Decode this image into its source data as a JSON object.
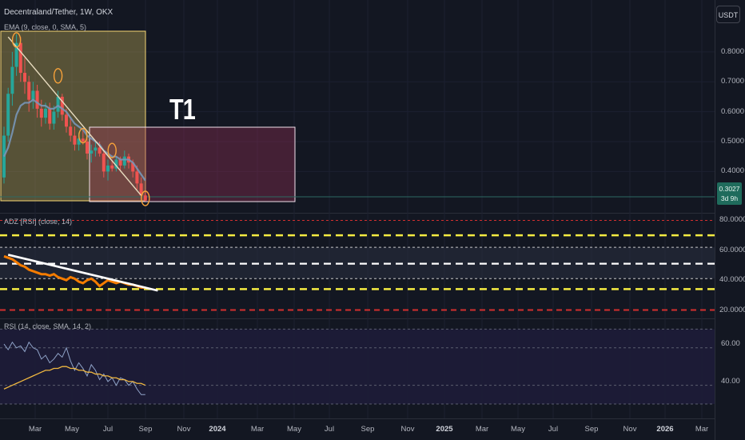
{
  "header": {
    "symbol_title": "Decentraland/Tether, 1W, OKX",
    "indicator_1": "EMA (9, close, 0, SMA, 5)",
    "currency_button": "USDT",
    "price_tag": "0.3027",
    "price_countdown": "3d 9h",
    "annotation": "T1"
  },
  "panes": {
    "adz_title": "ADZ [RSI] (close, 14)",
    "rsi_title": "RSI (14, close, SMA, 14, 2)"
  },
  "colors": {
    "background": "#131722",
    "bull": "#26a69a",
    "bear": "#ef5350",
    "ema": "#7896b8",
    "trendline": "#e8dcc0",
    "zone_yellow": "#c8b45a",
    "zone_pink": "#a0325a",
    "circle": "#f7a23a",
    "rsi_line": "#f57c00",
    "rsi_thin": "#8fa3c8",
    "rsi_ma": "#f0b840",
    "dash_yellow": "#f5ec42",
    "dash_red": "#d32f2f"
  },
  "axes": {
    "price_ticks": [
      "0.8000",
      "0.7000",
      "0.6000",
      "0.5000",
      "0.4000"
    ],
    "adz_ticks": [
      "80.0000",
      "60.0000",
      "40.0000",
      "20.0000"
    ],
    "rsi_ticks": [
      "60.00",
      "40.00"
    ],
    "time_ticks": [
      {
        "label": "Mar",
        "bold": false
      },
      {
        "label": "May",
        "bold": false
      },
      {
        "label": "Jul",
        "bold": false
      },
      {
        "label": "Sep",
        "bold": false
      },
      {
        "label": "Nov",
        "bold": false
      },
      {
        "label": "2024",
        "bold": true
      },
      {
        "label": "Mar",
        "bold": false
      },
      {
        "label": "May",
        "bold": false
      },
      {
        "label": "Jul",
        "bold": false
      },
      {
        "label": "Sep",
        "bold": false
      },
      {
        "label": "Nov",
        "bold": false
      },
      {
        "label": "2025",
        "bold": true
      },
      {
        "label": "Mar",
        "bold": false
      },
      {
        "label": "May",
        "bold": false
      },
      {
        "label": "Jul",
        "bold": false
      },
      {
        "label": "Sep",
        "bold": false
      },
      {
        "label": "Nov",
        "bold": false
      },
      {
        "label": "2026",
        "bold": true
      },
      {
        "label": "Mar",
        "bold": false
      }
    ]
  },
  "chart_data": [
    {
      "type": "candlestick",
      "ylim": [
        0.31,
        0.88
      ],
      "current_price": 0.3027,
      "price_line": 0.31,
      "candles": [
        [
          0.38,
          0.55,
          0.36,
          0.52
        ],
        [
          0.52,
          0.68,
          0.5,
          0.66
        ],
        [
          0.66,
          0.8,
          0.62,
          0.75
        ],
        [
          0.75,
          0.86,
          0.72,
          0.83
        ],
        [
          0.83,
          0.85,
          0.7,
          0.73
        ],
        [
          0.73,
          0.78,
          0.66,
          0.7
        ],
        [
          0.7,
          0.72,
          0.6,
          0.64
        ],
        [
          0.64,
          0.7,
          0.61,
          0.67
        ],
        [
          0.67,
          0.69,
          0.58,
          0.61
        ],
        [
          0.61,
          0.64,
          0.55,
          0.58
        ],
        [
          0.58,
          0.63,
          0.56,
          0.61
        ],
        [
          0.61,
          0.63,
          0.54,
          0.56
        ],
        [
          0.56,
          0.62,
          0.54,
          0.6
        ],
        [
          0.6,
          0.67,
          0.58,
          0.65
        ],
        [
          0.65,
          0.66,
          0.57,
          0.59
        ],
        [
          0.59,
          0.61,
          0.53,
          0.55
        ],
        [
          0.55,
          0.58,
          0.5,
          0.52
        ],
        [
          0.52,
          0.55,
          0.47,
          0.49
        ],
        [
          0.49,
          0.53,
          0.47,
          0.51
        ],
        [
          0.51,
          0.54,
          0.49,
          0.5
        ],
        [
          0.5,
          0.52,
          0.44,
          0.46
        ],
        [
          0.46,
          0.49,
          0.43,
          0.47
        ],
        [
          0.47,
          0.5,
          0.45,
          0.48
        ],
        [
          0.48,
          0.5,
          0.45,
          0.46
        ],
        [
          0.46,
          0.47,
          0.38,
          0.4
        ],
        [
          0.4,
          0.44,
          0.37,
          0.42
        ],
        [
          0.42,
          0.44,
          0.4,
          0.41
        ],
        [
          0.41,
          0.45,
          0.4,
          0.44
        ],
        [
          0.44,
          0.45,
          0.4,
          0.42
        ],
        [
          0.42,
          0.47,
          0.41,
          0.45
        ],
        [
          0.45,
          0.46,
          0.41,
          0.43
        ],
        [
          0.43,
          0.44,
          0.38,
          0.4
        ],
        [
          0.4,
          0.42,
          0.34,
          0.36
        ],
        [
          0.36,
          0.38,
          0.31,
          0.32
        ],
        [
          0.32,
          0.33,
          0.3,
          0.3027
        ]
      ],
      "ema": [
        0.45,
        0.48,
        0.53,
        0.59,
        0.62,
        0.63,
        0.63,
        0.64,
        0.63,
        0.62,
        0.62,
        0.61,
        0.61,
        0.62,
        0.61,
        0.6,
        0.58,
        0.56,
        0.55,
        0.54,
        0.52,
        0.51,
        0.5,
        0.49,
        0.47,
        0.46,
        0.45,
        0.45,
        0.44,
        0.44,
        0.44,
        0.43,
        0.41,
        0.39,
        0.37
      ],
      "trendline": [
        [
          1,
          0.85
        ],
        [
          33,
          0.32
        ]
      ],
      "circles": [
        [
          3,
          0.84
        ],
        [
          13,
          0.72
        ],
        [
          19,
          0.52
        ],
        [
          26,
          0.47
        ],
        [
          34,
          0.31
        ]
      ]
    },
    {
      "type": "line",
      "name": "ADZ [RSI]",
      "ylim": [
        16,
        84
      ],
      "levels": {
        "red_top": 80,
        "yellow_top": 70,
        "white_1": 62,
        "white_2": 51,
        "white_3": 41,
        "yellow_bottom": 34,
        "red_bottom": 20
      },
      "values": [
        56,
        55,
        54,
        52,
        50,
        49,
        47,
        46,
        45,
        44,
        44,
        43,
        44,
        42,
        41,
        40,
        42,
        41,
        39,
        38,
        40,
        41,
        39,
        36,
        38,
        40,
        39,
        38,
        39,
        38,
        37,
        37,
        36,
        35,
        35
      ],
      "trendline": [
        [
          1,
          57
        ],
        [
          37,
          33
        ]
      ]
    },
    {
      "type": "line",
      "name": "RSI",
      "ylim": [
        28,
        72
      ],
      "levels": [
        68,
        58,
        38,
        28
      ],
      "rsi": [
        60,
        57,
        61,
        58,
        59,
        56,
        61,
        58,
        57,
        52,
        54,
        50,
        52,
        55,
        53,
        58,
        51,
        46,
        50,
        47,
        43,
        49,
        46,
        41,
        44,
        40,
        42,
        38,
        42,
        41,
        38,
        40,
        36,
        33,
        33
      ],
      "rsi_ma": [
        36,
        37,
        38,
        39,
        40,
        41,
        42,
        43,
        44,
        45,
        46,
        46,
        47,
        47,
        48,
        48,
        47,
        47,
        46,
        46,
        45,
        45,
        44,
        44,
        43,
        43,
        42,
        42,
        41,
        41,
        40,
        40,
        39,
        39,
        38
      ]
    }
  ]
}
